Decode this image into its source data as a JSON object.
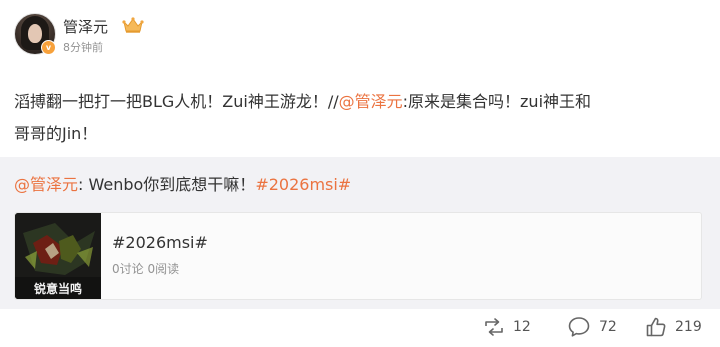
{
  "user": {
    "name": "管泽元",
    "time": "8分钟前",
    "verified_mark": "v",
    "badge_icon": "crown-icon"
  },
  "post": {
    "text_before": "滔搏翻一把打一把BLG人机！Zui神王游龙！//",
    "mention": "@管泽元",
    "text_after": ":原来是集合吗！zui神王和",
    "line2": "哥哥的Jin！"
  },
  "repost": {
    "mention": "@管泽元",
    "text": ": Wenbo你到底想干嘛！",
    "topic": "#2026msi#"
  },
  "card": {
    "title": "#2026msi#",
    "stats": "0讨论 0阅读",
    "image_caption": "锐意当鸣"
  },
  "actions": {
    "reposts": "12",
    "comments": "72",
    "likes": "219"
  },
  "colors": {
    "accent": "#eb7340",
    "repost_bg": "#f2f2f5",
    "badge": "#f7a13b"
  }
}
